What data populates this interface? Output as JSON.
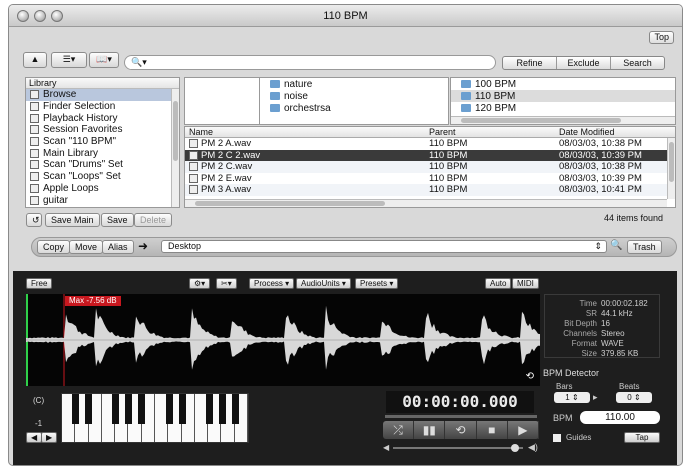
{
  "window": {
    "title": "110 BPM",
    "top_button": "Top"
  },
  "toolbar": {
    "eject_icon": "eject-icon",
    "list_icon": "list-view-icon",
    "book_icon": "book-icon",
    "search_value": "",
    "refine": "Refine",
    "exclude": "Exclude",
    "search_btn": "Search"
  },
  "library": {
    "header": "Library",
    "items": [
      {
        "label": "Browse",
        "icon": "browse-icon",
        "selected": true
      },
      {
        "label": "Finder Selection",
        "icon": "finder-icon"
      },
      {
        "label": "Playback History",
        "icon": "history-icon"
      },
      {
        "label": "Session Favorites",
        "icon": "favorites-icon"
      },
      {
        "label": "Scan \"110 BPM\"",
        "icon": "scan-icon"
      },
      {
        "label": "Main Library",
        "icon": "library-icon"
      },
      {
        "label": "Scan \"Drums\" Set",
        "icon": "scan-icon"
      },
      {
        "label": "Scan \"Loops\" Set",
        "icon": "scan-icon"
      },
      {
        "label": "Apple Loops",
        "icon": "folder-icon"
      },
      {
        "label": "guitar",
        "icon": "folder-icon"
      }
    ]
  },
  "columns": {
    "middle": [
      "nature",
      "noise",
      "orchestrsa"
    ],
    "right": [
      "100 BPM",
      "110 BPM",
      "120 BPM"
    ]
  },
  "files": {
    "headers": [
      "Name",
      "Parent",
      "Date Modified"
    ],
    "rows": [
      [
        "PM 2 A.wav",
        "110 BPM",
        "08/03/03, 10:38 PM"
      ],
      [
        "PM 2 C 2.wav",
        "110 BPM",
        "08/03/03, 10:39 PM"
      ],
      [
        "PM 2 C.wav",
        "110 BPM",
        "08/03/03, 10:38 PM"
      ],
      [
        "PM 2 E.wav",
        "110 BPM",
        "08/03/03, 10:39 PM"
      ],
      [
        "PM 3 A.wav",
        "110 BPM",
        "08/03/03, 10:41 PM"
      ]
    ],
    "selected_index": 1
  },
  "buttons": {
    "save_main": "Save Main",
    "save": "Save",
    "delete": "Delete"
  },
  "item_count": "44 items found",
  "pathbar": {
    "copy": "Copy",
    "move": "Move",
    "alias": "Alias",
    "destination": "Desktop",
    "trash": "Trash"
  },
  "player": {
    "free": "Free",
    "process": "Process ▾",
    "audiounits": "AudioUnits ▾",
    "presets": "Presets ▾",
    "auto": "Auto",
    "midi": "MIDI",
    "max_label": "Max -7.56 dB",
    "info": [
      {
        "k": "Time",
        "v": "00:00:02.182"
      },
      {
        "k": "SR",
        "v": "44.1 kHz"
      },
      {
        "k": "Bit Depth",
        "v": "16"
      },
      {
        "k": "Channels",
        "v": "Stereo"
      },
      {
        "k": "Format",
        "v": "WAVE"
      },
      {
        "k": "Size",
        "v": "379.85 KB"
      }
    ],
    "timecode": "00:00:00.000",
    "bpm_detector": "BPM Detector",
    "bars_label": "Bars",
    "beats_label": "Beats",
    "bars_value": "1",
    "beats_value": "0",
    "bpm_label": "BPM",
    "bpm_value": "110.00",
    "guides": "Guides",
    "tap": "Tap",
    "octave": "-1",
    "c_label": "(C)"
  },
  "colors": {
    "selection": "#b9c7dd",
    "wave": "#d8d8d8",
    "max_badge": "#c8181f",
    "playhead": "#2fd14a"
  }
}
